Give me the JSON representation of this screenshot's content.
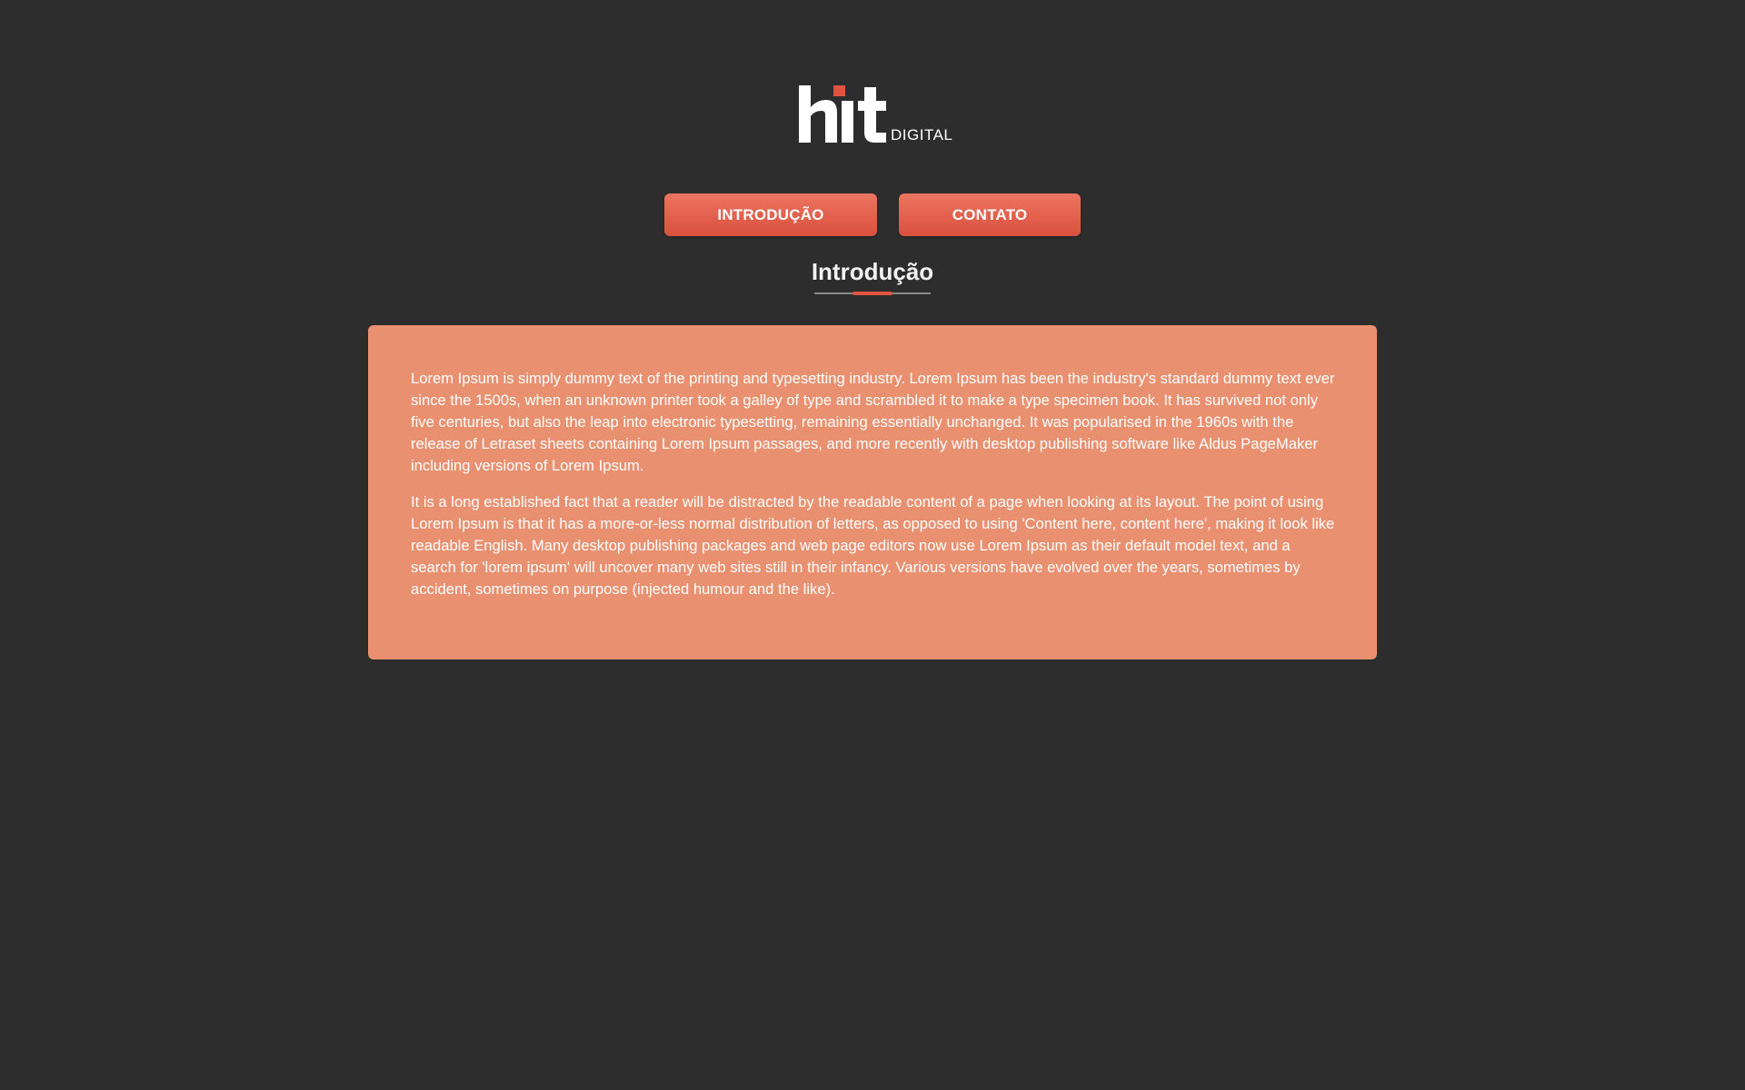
{
  "header": {
    "logo_text": "hit",
    "logo_subtext": "DIGITAL"
  },
  "nav": {
    "items": [
      {
        "label": "INTRODUÇÃO"
      },
      {
        "label": "CONTATO"
      }
    ]
  },
  "section": {
    "title": "Introdução",
    "paragraphs": [
      "Lorem Ipsum is simply dummy text of the printing and typesetting industry. Lorem Ipsum has been the industry's standard dummy text ever since the 1500s, when an unknown printer took a galley of type and scrambled it to make a type specimen book. It has survived not only five centuries, but also the leap into electronic typesetting, remaining essentially unchanged. It was popularised in the 1960s with the release of Letraset sheets containing Lorem Ipsum passages, and more recently with desktop publishing software like Aldus PageMaker including versions of Lorem Ipsum.",
      "It is a long established fact that a reader will be distracted by the readable content of a page when looking at its layout. The point of using Lorem Ipsum is that it has a more-or-less normal distribution of letters, as opposed to using 'Content here, content here', making it look like readable English. Many desktop publishing packages and web page editors now use Lorem Ipsum as their default model text, and a search for 'lorem ipsum' will uncover many web sites still in their infancy. Various versions have evolved over the years, sometimes by accident, sometimes on purpose (injected humour and the like)."
    ]
  },
  "colors": {
    "background": "#2d2d2d",
    "accent": "#e0533f",
    "button": "#e5604c",
    "card": "#e8906f",
    "text": "#ffffff"
  }
}
